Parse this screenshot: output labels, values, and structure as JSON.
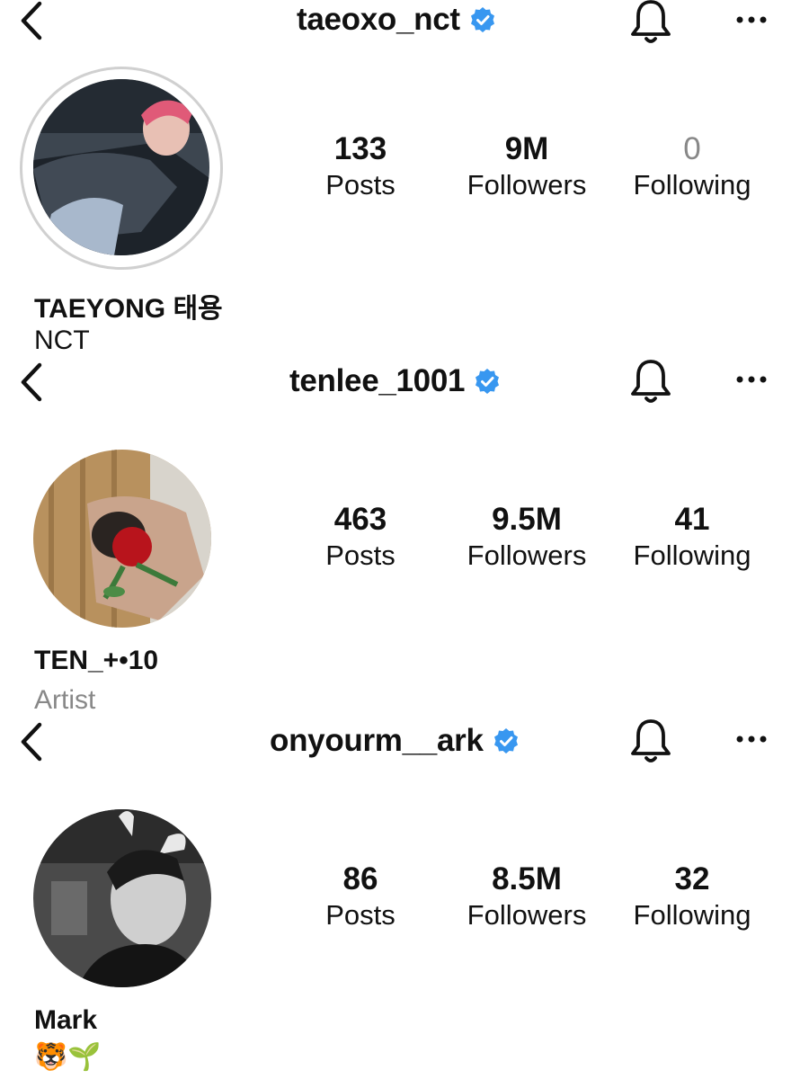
{
  "profiles": [
    {
      "username": "taeoxo_nct",
      "display_name": "TAEYONG 태용",
      "bio": "NCT",
      "stats": {
        "posts": "133",
        "followers": "9M",
        "following": "0"
      },
      "labels": {
        "posts": "Posts",
        "followers": "Followers",
        "following": "Following"
      }
    },
    {
      "username": "tenlee_1001",
      "display_name": "TEN_+•10",
      "bio": "Artist",
      "stats": {
        "posts": "463",
        "followers": "9.5M",
        "following": "41"
      },
      "labels": {
        "posts": "Posts",
        "followers": "Followers",
        "following": "Following"
      }
    },
    {
      "username": "onyourm__ark",
      "display_name": "Mark",
      "bio": "🐯🌱",
      "stats": {
        "posts": "86",
        "followers": "8.5M",
        "following": "32"
      },
      "labels": {
        "posts": "Posts",
        "followers": "Followers",
        "following": "Following"
      }
    }
  ],
  "colors": {
    "verified": "#3897f0",
    "text": "#111111",
    "muted": "#888888"
  },
  "icons": [
    "back-chevron-icon",
    "verified-badge-icon",
    "bell-icon",
    "more-options-icon"
  ]
}
